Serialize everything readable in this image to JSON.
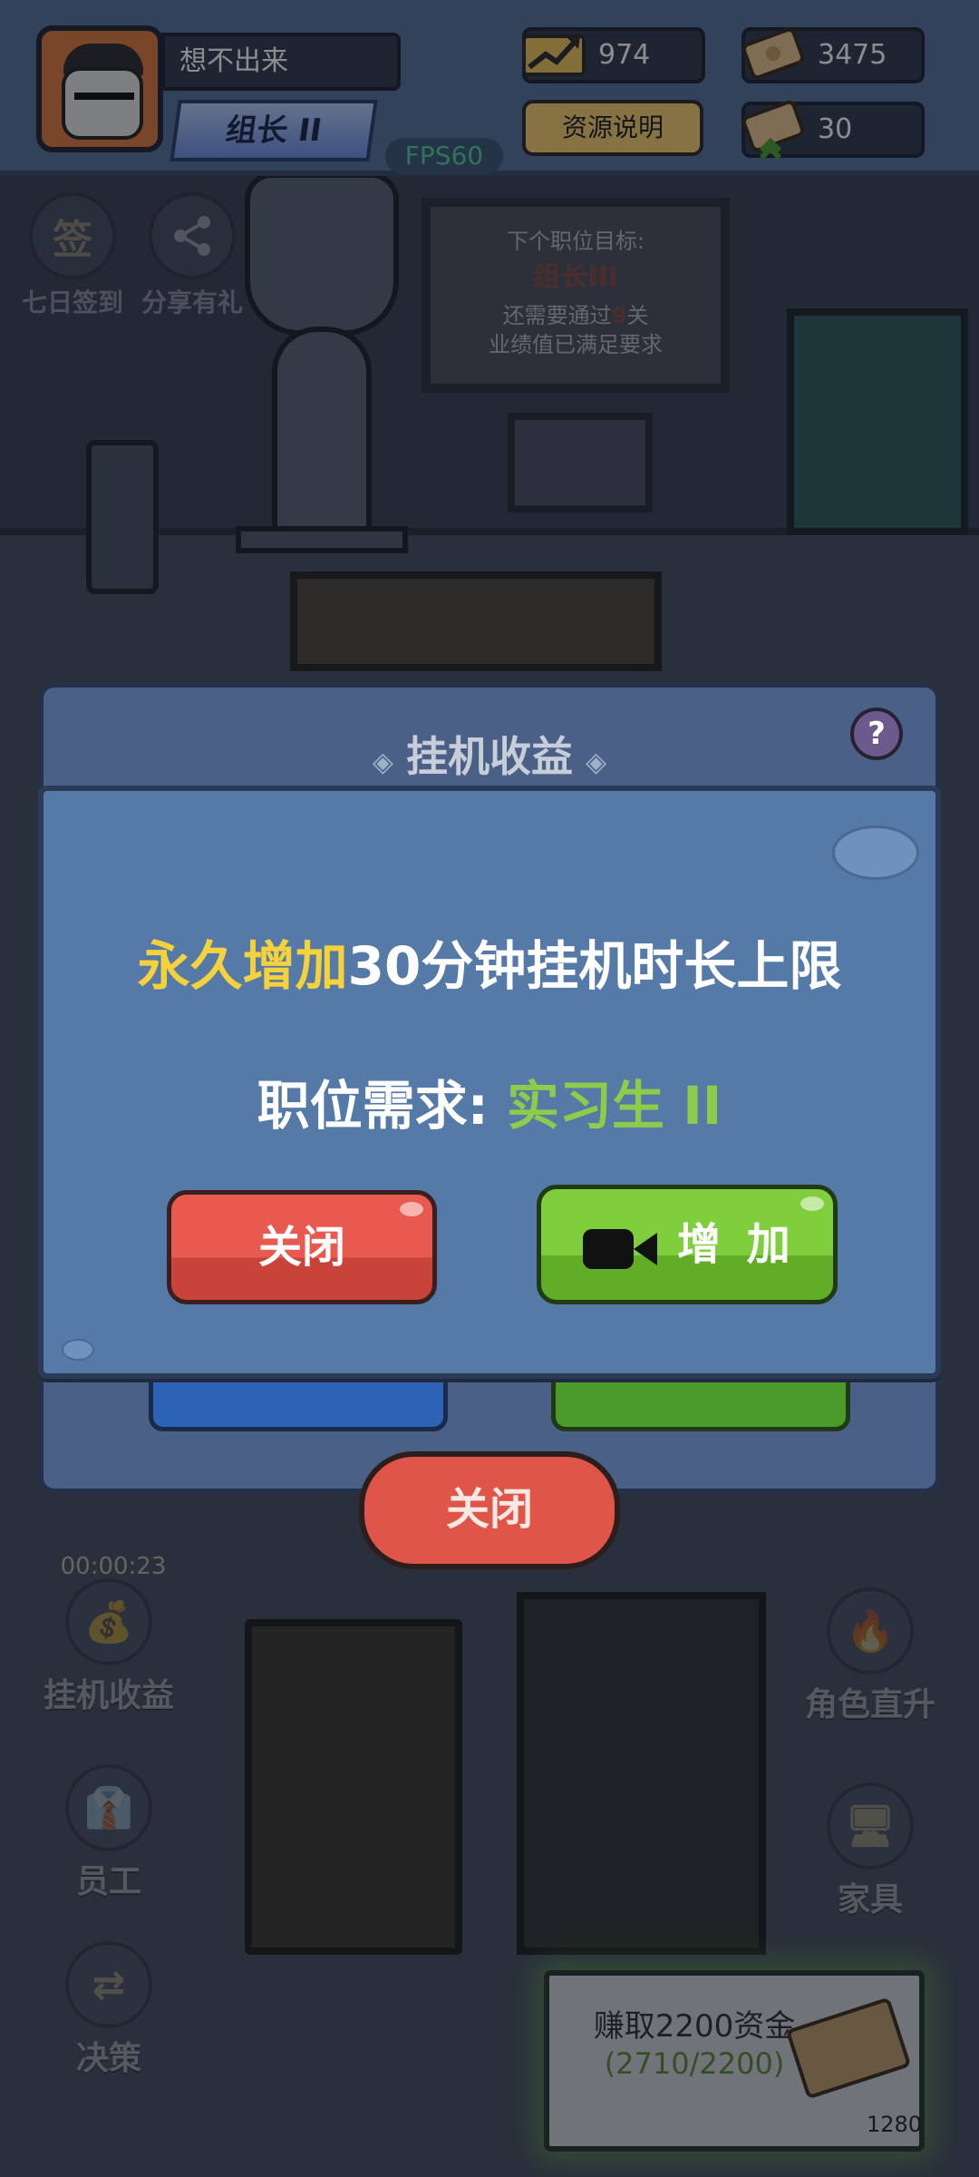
{
  "header": {
    "player_name": "想不出来",
    "rank": "组长 II",
    "fps": "FPS60",
    "resources": {
      "performance": "974",
      "money": "3475",
      "money_growth": "30"
    },
    "resource_info_label": "资源说明"
  },
  "side_buttons": {
    "checkin_icon_text": "签",
    "checkin": "七日签到",
    "share": "分享有礼",
    "idle_income": "挂机收益",
    "staff": "员工",
    "decision": "决策",
    "character_upgrade": "角色直升",
    "furniture": "家具",
    "idle_timer": "00:00:23"
  },
  "board": {
    "line1": "下个职位目标:",
    "line2": "组长III",
    "line3_prefix": "还需要通过",
    "line3_num": "9",
    "line3_suffix": "关",
    "line4": "业绩值已满足要求"
  },
  "back_panel": {
    "title": "挂机收益",
    "help": "?",
    "close_label": "关闭"
  },
  "dialog": {
    "highlight": "永久增加",
    "message_rest": "30分钟挂机时长上限",
    "requirement_label": "职位需求:",
    "requirement_value": "实习生 II",
    "close_button": "关闭",
    "add_button": "增 加"
  },
  "earn_task": {
    "title": "赚取2200资金",
    "progress": "(2710/2200)",
    "reward": "1280"
  },
  "colors": {
    "highlight_yellow": "#f5d13c",
    "requirement_green": "#8dcb4a",
    "close_red": "#e85a4f",
    "add_green": "#7fcf3c",
    "dialog_blue": "#557aa8",
    "fps_green": "#4fd19a"
  }
}
